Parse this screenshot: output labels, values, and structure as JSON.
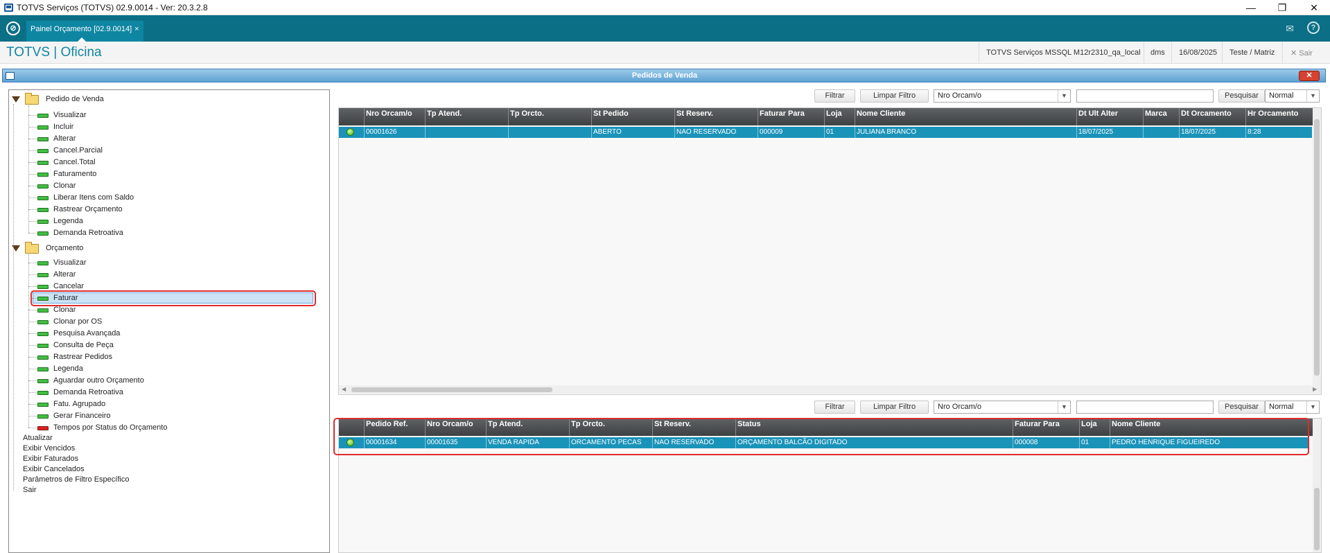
{
  "window": {
    "title": "TOTVS Serviços (TOTVS) 02.9.0014 - Ver: 20.3.2.8",
    "minimize": "—",
    "restore": "❐",
    "close": "✕"
  },
  "tabbar": {
    "tab_label": "Painel Orçamento [02.9.0014]",
    "tab_close": "×",
    "mail_icon": "✉",
    "help_icon": "?"
  },
  "header": {
    "brand": "TOTVS | Oficina",
    "environment": "TOTVS Serviços MSSQL M12r2310_qa_local",
    "user": "dms",
    "date": "16/08/2025",
    "company": "Teste / Matriz",
    "exit": "✕ Sair"
  },
  "panel": {
    "title": "Pedidos de Venda",
    "close": "✕"
  },
  "tree": {
    "pedido_folder": "Pedido de Venda",
    "pedido_items": [
      "Visualizar",
      "Incluir",
      "Alterar",
      "Cancel.Parcial",
      "Cancel.Total",
      "Faturamento",
      "Clonar",
      "Liberar Itens com Saldo",
      "Rastrear Orçamento",
      "Legenda",
      "Demanda Retroativa"
    ],
    "orcamento_folder": "Orçamento",
    "orcamento_items": [
      "Visualizar",
      "Alterar",
      "Cancelar",
      "Faturar",
      "Clonar",
      "Clonar por OS",
      "Pesquisa Avançada",
      "Consulta de Peça",
      "Rastrear Pedidos",
      "Legenda",
      "Aguardar outro Orçamento",
      "Demanda Retroativa",
      "Fatu. Agrupado",
      "Gerar Financeiro",
      "Tempos por Status do Orçamento"
    ],
    "root_items": [
      "Atualizar",
      "Exibir Vencidos",
      "Exibir Faturados",
      "Exibir Cancelados",
      "Parâmetros de Filtro Específico",
      "Sair"
    ]
  },
  "top_toolbar": {
    "filtrar": "Filtrar",
    "limpar": "Limpar Filtro",
    "search_field": "Nro Orcam/o",
    "search_value": "",
    "pesquisar": "Pesquisar",
    "mode": "Normal"
  },
  "top_grid": {
    "columns": [
      "Nro Orcam/o",
      "Tp Atend.",
      "Tp Orcto.",
      "St Pedido",
      "St Reserv.",
      "Faturar Para",
      "Loja",
      "Nome Cliente",
      "Dt Ult Alter",
      "Marca",
      "Dt Orcamento",
      "Hr Orcamento"
    ],
    "rows": [
      [
        "00001626",
        "",
        "",
        "ABERTO",
        "NAO RESERVADO",
        "000009",
        "01",
        "JULIANA BRANCO",
        "18/07/2025",
        "",
        "18/07/2025",
        "8:28"
      ]
    ]
  },
  "bottom_toolbar": {
    "filtrar": "Filtrar",
    "limpar": "Limpar Filtro",
    "search_field": "Nro Orcam/o",
    "search_value": "",
    "pesquisar": "Pesquisar",
    "mode": "Normal"
  },
  "bottom_grid": {
    "columns": [
      "Pedido Ref.",
      "Nro Orcam/o",
      "Tp Atend.",
      "Tp Orcto.",
      "St Reserv.",
      "Status",
      "Faturar Para",
      "Loja",
      "Nome Cliente"
    ],
    "rows": [
      [
        "00001634",
        "00001635",
        "VENDA RAPIDA",
        "ORCAMENTO PECAS",
        "NAO RESERVADO",
        "ORÇAMENTO BALCÃO DIGITADO",
        "000008",
        "01",
        "PEDRO HENRIQUE FIGUEIREDO"
      ]
    ]
  },
  "colors": {
    "tabbar": "#0b6f86",
    "brand": "#0e86a2",
    "selected_row": "#1a93b9",
    "highlight": "#e02b2b"
  }
}
